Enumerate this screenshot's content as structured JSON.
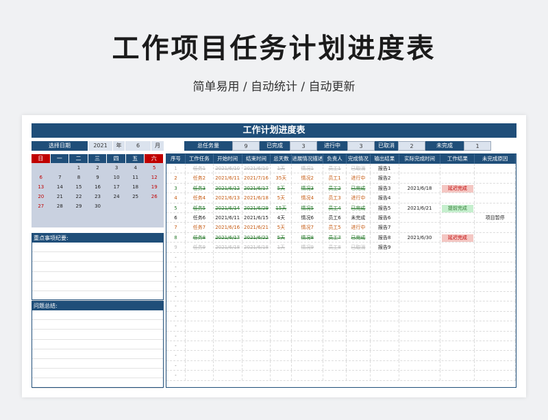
{
  "hero": {
    "title": "工作项目任务计划进度表",
    "subtitle": "简单易用 / 自动统计 / 自动更新"
  },
  "sheet": {
    "title": "工作计划进度表",
    "date_picker": {
      "label": "选择日期",
      "year": "2021",
      "year_unit": "年",
      "month": "6",
      "month_unit": "月"
    },
    "stats": [
      {
        "label": "总任务量",
        "value": "9"
      },
      {
        "label": "已完成",
        "value": "3"
      },
      {
        "label": "进行中",
        "value": "3"
      },
      {
        "label": "已取消",
        "value": "2"
      },
      {
        "label": "未完成",
        "value": "1"
      }
    ],
    "calendar": {
      "weekdays": [
        "日",
        "一",
        "二",
        "三",
        "四",
        "五",
        "六"
      ],
      "weeks": [
        [
          "",
          "",
          "1",
          "2",
          "3",
          "4",
          "5"
        ],
        [
          "6",
          "7",
          "8",
          "9",
          "10",
          "11",
          "12"
        ],
        [
          "13",
          "14",
          "15",
          "16",
          "17",
          "18",
          "19"
        ],
        [
          "20",
          "21",
          "22",
          "23",
          "24",
          "25",
          "26"
        ],
        [
          "27",
          "28",
          "29",
          "30",
          "",
          "",
          ""
        ],
        [
          "",
          "",
          "",
          "",
          "",
          "",
          ""
        ]
      ]
    },
    "notes_title": "重点事项纪要:",
    "problems_title": "问题总结:",
    "table": {
      "headers": [
        "序号",
        "工作任务",
        "开始时间",
        "结束时间",
        "总天数",
        "进展情况描述",
        "负责人",
        "完成情况",
        "输出结果",
        "实际完成时间",
        "工作结果",
        "未完成原因"
      ],
      "rows": [
        {
          "no": "1",
          "task": "任务1",
          "start": "2021/6/10",
          "end": "2021/6/10",
          "days": "1天",
          "desc": "情况1",
          "owner": "员工1",
          "status": "已取消",
          "output": "报告1",
          "actual": "",
          "result": "",
          "reason": ""
        },
        {
          "no": "2",
          "task": "任务2",
          "start": "2021/6/11",
          "end": "2021/7/16",
          "days": "35天",
          "desc": "情况2",
          "owner": "员工1",
          "status": "进行中",
          "output": "报告2",
          "actual": "",
          "result": "",
          "reason": ""
        },
        {
          "no": "3",
          "task": "任务3",
          "start": "2021/6/12",
          "end": "2021/6/17",
          "days": "5天",
          "desc": "情况3",
          "owner": "员工2",
          "status": "已完成",
          "output": "报告3",
          "actual": "2021/6/18",
          "result": "延迟完成",
          "reason": ""
        },
        {
          "no": "4",
          "task": "任务4",
          "start": "2021/6/13",
          "end": "2021/6/18",
          "days": "5天",
          "desc": "情况4",
          "owner": "员工3",
          "status": "进行中",
          "output": "报告4",
          "actual": "",
          "result": "",
          "reason": ""
        },
        {
          "no": "5",
          "task": "任务5",
          "start": "2021/6/14",
          "end": "2021/6/29",
          "days": "15天",
          "desc": "情况5",
          "owner": "员工4",
          "status": "已完成",
          "output": "报告5",
          "actual": "2021/6/21",
          "result": "提前完成",
          "reason": ""
        },
        {
          "no": "6",
          "task": "任务6",
          "start": "2021/6/11",
          "end": "2021/6/15",
          "days": "4天",
          "desc": "情况6",
          "owner": "员工6",
          "status": "未完成",
          "output": "报告6",
          "actual": "",
          "result": "",
          "reason": "项目暂停"
        },
        {
          "no": "7",
          "task": "任务7",
          "start": "2021/6/16",
          "end": "2021/6/21",
          "days": "5天",
          "desc": "情况7",
          "owner": "员工5",
          "status": "进行中",
          "output": "报告7",
          "actual": "",
          "result": "",
          "reason": ""
        },
        {
          "no": "8",
          "task": "任务8",
          "start": "2021/6/17",
          "end": "2021/6/22",
          "days": "5天",
          "desc": "情况8",
          "owner": "员工7",
          "status": "已完成",
          "output": "报告8",
          "actual": "2021/6/30",
          "result": "延迟完成",
          "reason": ""
        },
        {
          "no": "9",
          "task": "任务9",
          "start": "2021/6/18",
          "end": "2021/6/18",
          "days": "1天",
          "desc": "情况9",
          "owner": "员工8",
          "status": "已取消",
          "output": "报告9",
          "actual": "",
          "result": "",
          "reason": ""
        }
      ],
      "empty_row_marker": "-"
    }
  },
  "colors": {
    "header_navy": "#1f4e79",
    "weekend_red": "#c00000",
    "in_progress": "#c55a11",
    "completed": "#2e7d32",
    "cancelled": "#bbbbbb",
    "delay_badge_bg": "#f4c7c3",
    "early_badge_bg": "#c6efce"
  }
}
